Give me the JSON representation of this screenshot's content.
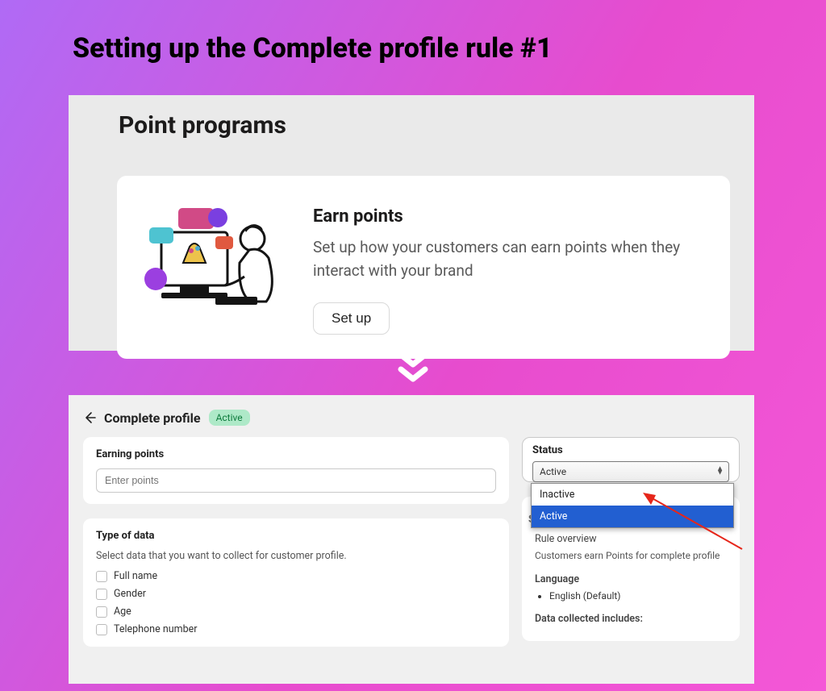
{
  "title": "Setting up the Complete profile rule #1",
  "topPanel": {
    "heading": "Point programs",
    "card": {
      "title": "Earn points",
      "description": "Set up how your customers can earn points when they interact with your brand",
      "button_label": "Set up"
    }
  },
  "bottomPanel": {
    "header_title": "Complete profile",
    "header_badge": "Active",
    "earning": {
      "title": "Earning points",
      "placeholder": "Enter points"
    },
    "typeOfData": {
      "title": "Type of data",
      "subtitle": "Select data that you want to collect for customer profile.",
      "checkboxes": [
        "Full name",
        "Gender",
        "Age",
        "Telephone number"
      ]
    },
    "status": {
      "title": "Status",
      "selected": "Active",
      "options": [
        "Inactive",
        "Active"
      ]
    },
    "summary": {
      "title": "Summary",
      "rule_overview_label": "Rule overview",
      "rule_overview_text": "Customers earn Points for complete profile",
      "language_label": "Language",
      "language_list": [
        "English (Default)"
      ],
      "data_collected_label": "Data collected includes:"
    }
  }
}
